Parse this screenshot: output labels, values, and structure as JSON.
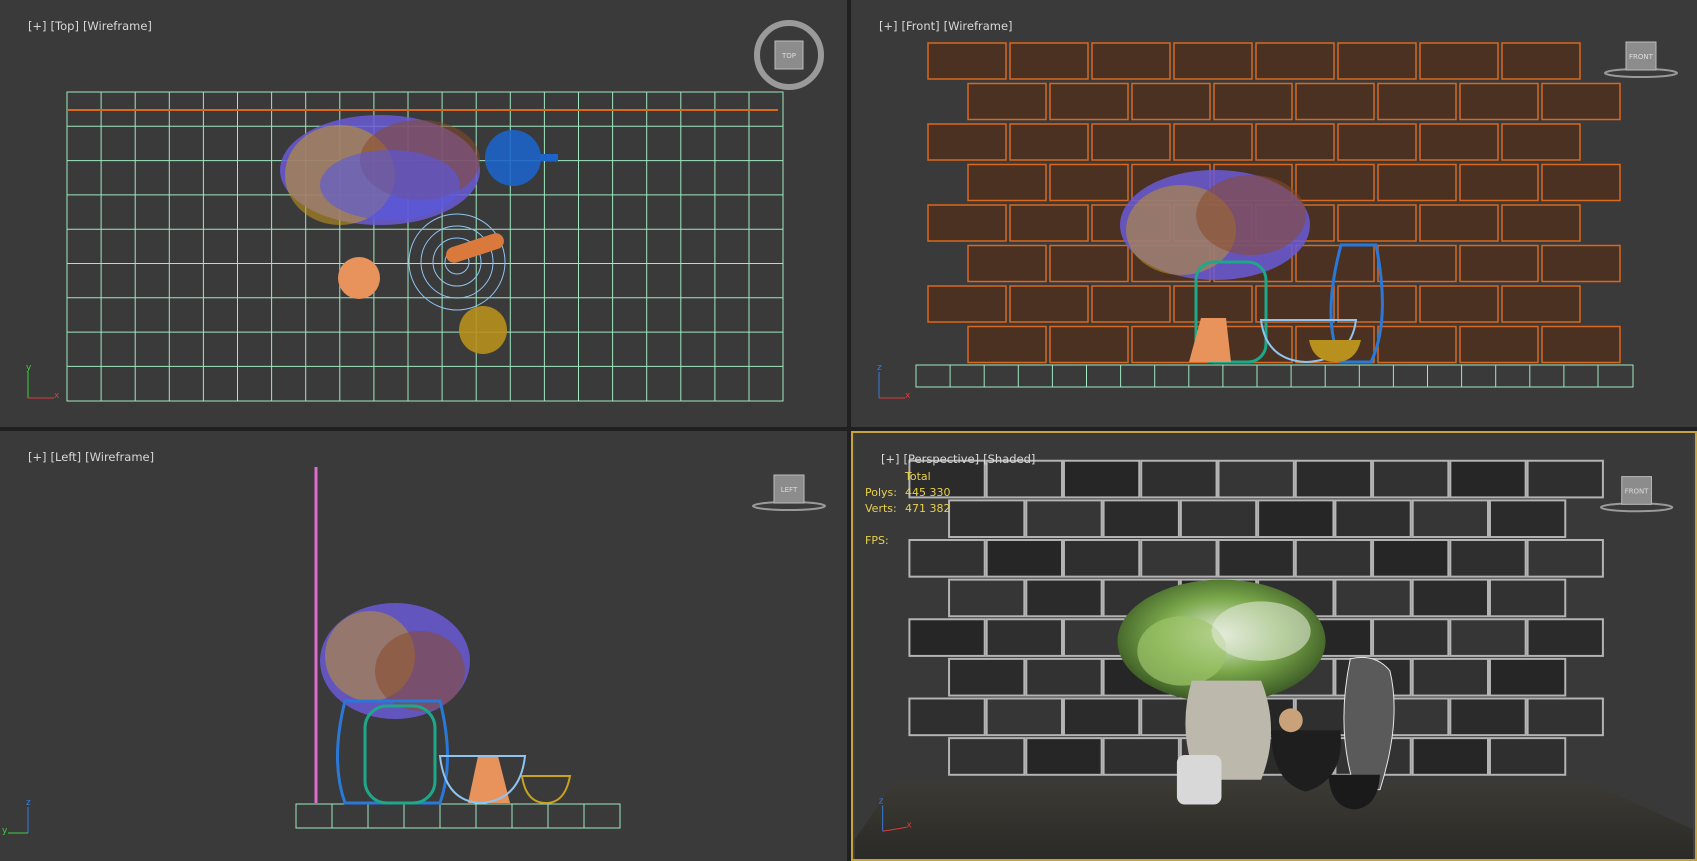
{
  "viewports": {
    "top": {
      "plus": "[+]",
      "view": "[Top]",
      "mode": "[Wireframe]",
      "cube": "TOP"
    },
    "front": {
      "plus": "[+]",
      "view": "[Front]",
      "mode": "[Wireframe]",
      "cube": "FRONT"
    },
    "left": {
      "plus": "[+]",
      "view": "[Left]",
      "mode": "[Wireframe]",
      "cube": "LEFT"
    },
    "persp": {
      "plus": "[+]",
      "view": "[Perspective]",
      "mode": "[Shaded]",
      "cube": "FRONT"
    }
  },
  "stats": {
    "header": "Total",
    "polys_label": "Polys:",
    "polys_value": "445 330",
    "verts_label": "Verts:",
    "verts_value": "471 382",
    "fps_label": "FPS:"
  },
  "axes": {
    "x": "x",
    "y": "y",
    "z": "z"
  },
  "colors": {
    "viewport_bg": "#3a3a3a",
    "active_border": "#c8a23c",
    "grid_line": "#9fe8c0",
    "brick_wire": "#d9681e",
    "stats_text": "#e8d14a"
  }
}
